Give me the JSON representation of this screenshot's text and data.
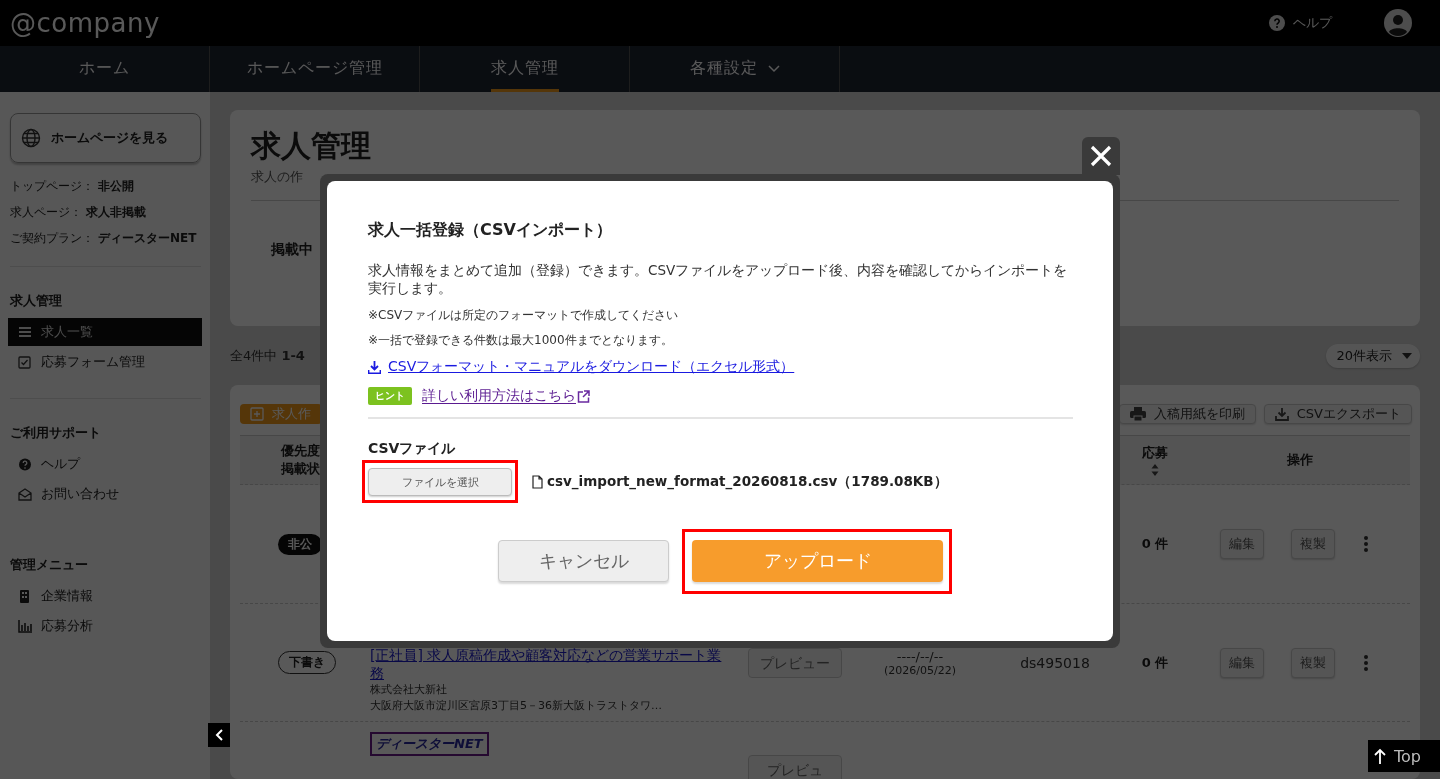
{
  "header": {
    "logo": "@company",
    "help": "ヘルプ"
  },
  "nav": {
    "tabs": [
      {
        "label": "ホーム",
        "selected": false,
        "dropdown": false
      },
      {
        "label": "ホームページ管理",
        "selected": false,
        "dropdown": false
      },
      {
        "label": "求人管理",
        "selected": true,
        "dropdown": false
      },
      {
        "label": "各種設定",
        "selected": false,
        "dropdown": true
      }
    ]
  },
  "sidebar": {
    "view_site_button": "ホームページを見る",
    "status": [
      {
        "label": "トップページ：",
        "value": "非公開"
      },
      {
        "label": "求人ページ：",
        "value": "求人非掲載"
      },
      {
        "label": "ご契約プラン：",
        "value": "ディースターNET"
      }
    ],
    "sections": [
      {
        "title": "求人管理",
        "items": [
          {
            "label": "求人一覧",
            "selected": true
          },
          {
            "label": "応募フォーム管理",
            "selected": false
          }
        ]
      },
      {
        "title": "ご利用サポート",
        "items": [
          {
            "label": "ヘルプ",
            "selected": false
          },
          {
            "label": "お問い合わせ",
            "selected": false
          }
        ]
      },
      {
        "title": "管理メニュー",
        "items": [
          {
            "label": "企業情報",
            "selected": false
          },
          {
            "label": "応募分析",
            "selected": false
          }
        ]
      }
    ]
  },
  "main": {
    "title": "求人管理",
    "subtitle": "求人の作",
    "summary_label": "掲載中",
    "count": "全4件中 **1-4**",
    "per_page": "20件表示",
    "create_button": "求人作",
    "print_button": "入稿用紙を印刷",
    "export_button": "CSVエクスポート",
    "table": {
      "columns": [
        [
          "優先度",
          "掲載状"
        ],
        [
          "応募"
        ],
        [
          "操作"
        ]
      ],
      "rows": [
        {
          "status": "非公",
          "kind": "private",
          "applications": "0 件",
          "edit": "編集",
          "copy": "複製"
        },
        {
          "status": "下書き",
          "kind": "draft",
          "title": "[正社員] 求人原稿作成や顧客対応などの営業サポート業務",
          "company": "株式会社大新社",
          "address": "大阪府大阪市淀川区宮原3丁目5－36新大阪トラストタワ…",
          "preview": "プレビュー",
          "date": "----/--/--",
          "date_sub": "(2026/05/22)",
          "id": "ds495018",
          "applications": "0 件",
          "edit": "編集",
          "copy": "複製"
        },
        {
          "logo": "ディースターNET",
          "preview": "プレビュ"
        }
      ]
    }
  },
  "modal": {
    "title": "求人一括登録（CSVインポート）",
    "description": "求人情報をまとめて追加（登録）できます。CSVファイルをアップロード後、内容を確認してからインポートを実行します。",
    "notes": [
      "※CSVファイルは所定のフォーマットで作成してください",
      "※一括で登録できる件数は最大1000件までとなります。"
    ],
    "download_link": "CSVフォーマット・マニュアルをダウンロード（エクセル形式）",
    "hint_badge": "ヒント",
    "hint_link": "詳しい利用方法はこちら",
    "file_label": "CSVファイル",
    "file_button": "ファイルを選択",
    "file_name": "csv_import_new_format_20260818.csv（1789.08KB）",
    "cancel": "キャンセル",
    "upload": "アップロード",
    "highlighted": {
      "file_button": true,
      "upload": true
    }
  },
  "top_button": "Top"
}
